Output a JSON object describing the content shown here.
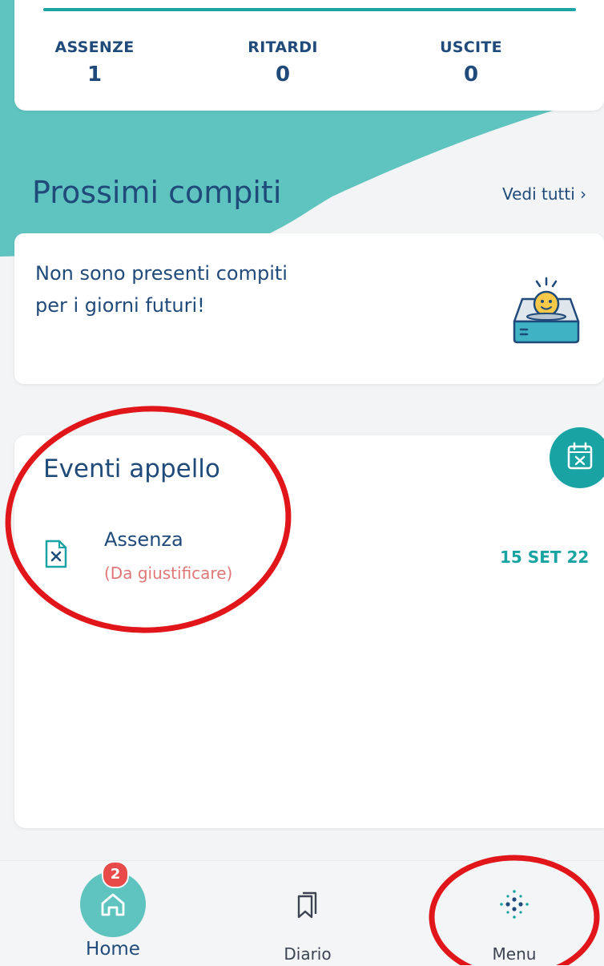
{
  "stats": {
    "items": [
      {
        "label": "ASSENZE",
        "value": "1"
      },
      {
        "label": "RITARDI",
        "value": "0"
      },
      {
        "label": "USCITE",
        "value": "0"
      }
    ]
  },
  "homework": {
    "title": "Prossimi compiti",
    "see_all": "Vedi tutti ›",
    "empty_message": "Non sono presenti compiti per i giorni futuri!",
    "empty_icon": "empty-tray-smiley-icon"
  },
  "events": {
    "title": "Eventi appello",
    "badge_icon": "calendar-x-icon",
    "items": [
      {
        "icon": "document-x-icon",
        "title": "Assenza",
        "status": "(Da giustificare)",
        "date": "15 SET 22"
      }
    ]
  },
  "nav": {
    "items": [
      {
        "label": "Home",
        "icon": "home-icon",
        "badge": "2",
        "active": true
      },
      {
        "label": "Diario",
        "icon": "bookmark-icon",
        "active": false
      },
      {
        "label": "Menu",
        "icon": "dots-grid-icon",
        "active": false
      }
    ]
  },
  "colors": {
    "teal": "#1aa3a3",
    "teal_light": "#5fc4c0",
    "navy": "#1f4a7a",
    "alert_red": "#e07777",
    "badge_red": "#e84a4a",
    "annotation_red": "#e0161a"
  }
}
